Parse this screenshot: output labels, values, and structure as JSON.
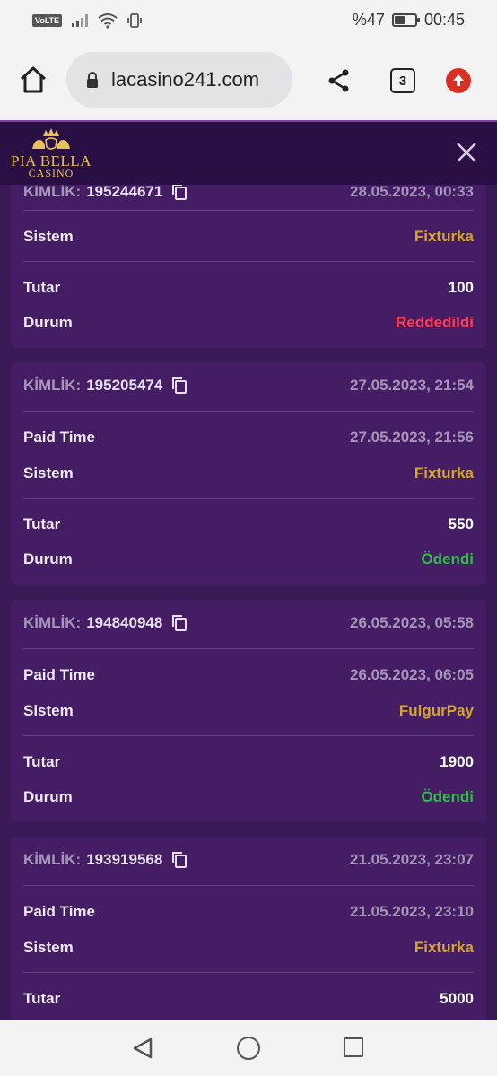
{
  "status_bar": {
    "volte": "VoLTE",
    "battery_text": "%47",
    "battery_level": 0.47,
    "time": "00:45"
  },
  "browser": {
    "url": "lacasino241.com",
    "tab_count": "3"
  },
  "site": {
    "logo_name": "PIA BELLA",
    "logo_sub": "CASINO"
  },
  "colors": {
    "background": "#3a1a56",
    "card": "#441d64",
    "header": "#2a0f44",
    "system": "#d4a52a",
    "rejected": "#ff3d56",
    "paid": "#2fbf48"
  },
  "labels": {
    "kimlik": "KİMLİK:",
    "paid_time": "Paid Time",
    "sistem": "Sistem",
    "tutar": "Tutar",
    "durum": "Durum"
  },
  "transactions": [
    {
      "id": "195244671",
      "date": "28.05.2023, 00:33",
      "sistem": "Fixturka",
      "tutar": "100",
      "durum": "Reddedildi"
    },
    {
      "id": "195205474",
      "date": "27.05.2023, 21:54",
      "paid_time": "27.05.2023, 21:56",
      "sistem": "Fixturka",
      "tutar": "550",
      "durum": "Ödendi"
    },
    {
      "id": "194840948",
      "date": "26.05.2023, 05:58",
      "paid_time": "26.05.2023, 06:05",
      "sistem": "FulgurPay",
      "tutar": "1900",
      "durum": "Ödendi"
    },
    {
      "id": "193919568",
      "date": "21.05.2023, 23:07",
      "paid_time": "21.05.2023, 23:10",
      "sistem": "Fixturka",
      "tutar": "5000"
    }
  ]
}
